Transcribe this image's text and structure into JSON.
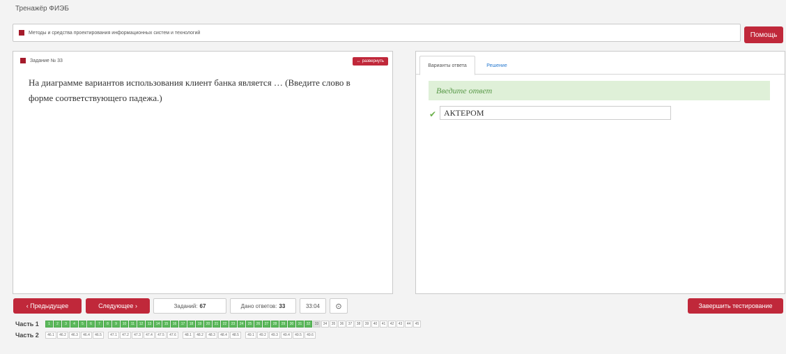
{
  "app_title": "Тренажёр ФИЭБ",
  "topbar": {
    "course": "Методы и средства проектирования информационных систем и технологий",
    "help_label": "Помощь"
  },
  "task": {
    "header": "Задание № 33",
    "expand_label": "развернуть",
    "question": "На диаграмме вариантов использования клиент банка является … (Введите слово в форме соответствующего падежа.)"
  },
  "tabs": {
    "answers": "Варианты ответа",
    "solution": "Решение"
  },
  "answer": {
    "hint": "Введите ответ",
    "value": "АКТЕРОМ"
  },
  "nav": {
    "prev_label": "Предыдущее",
    "next_label": "Следующее",
    "tasks_label": "Заданий:",
    "tasks_value": "67",
    "answered_label": "Дано ответов:",
    "answered_value": "33",
    "timer": "33:04",
    "finish_label": "Завершить тестирование"
  },
  "parts": {
    "part1_label": "Часть 1",
    "part2_label": "Часть 2",
    "part1_cells": [
      "1",
      "2",
      "3",
      "4",
      "5",
      "6",
      "7",
      "8",
      "9",
      "10",
      "11",
      "12",
      "13",
      "14",
      "15",
      "16",
      "17",
      "18",
      "19",
      "20",
      "21",
      "22",
      "23",
      "24",
      "25",
      "26",
      "27",
      "28",
      "29",
      "30",
      "31",
      "32",
      "33",
      "34",
      "35",
      "36",
      "37",
      "38",
      "39",
      "40",
      "41",
      "42",
      "43",
      "44",
      "45"
    ],
    "part1_done_count": 32,
    "part1_current": "33",
    "part2_groups": [
      [
        "46.1",
        "46.2",
        "46.3",
        "46.4",
        "46.5"
      ],
      [
        "47.1",
        "47.2",
        "47.3",
        "47.4",
        "47.5",
        "47.6"
      ],
      [
        "48.1",
        "48.2",
        "48.3",
        "48.4",
        "48.5"
      ],
      [
        "49.1",
        "49.2",
        "49.3",
        "49.4",
        "49.5",
        "49.6"
      ]
    ]
  },
  "colors": {
    "accent_red": "#c0283a",
    "success_green": "#5cb85c",
    "hint_bg": "#dff0d8",
    "link_blue": "#2a7bd0"
  }
}
